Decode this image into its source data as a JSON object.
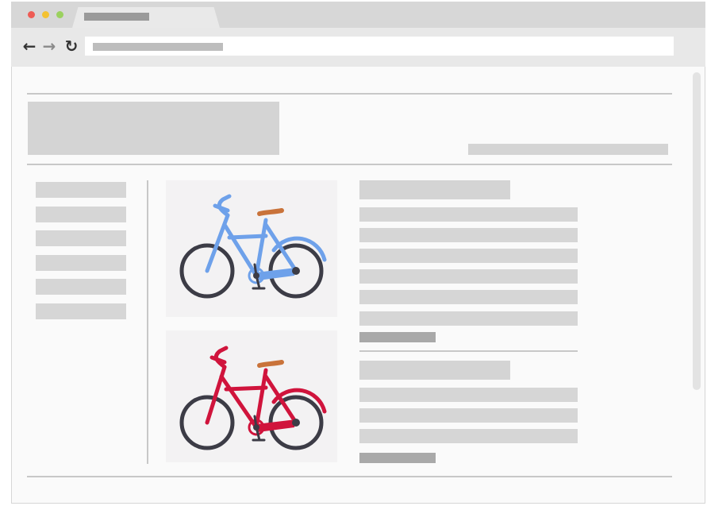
{
  "window": {
    "traffic_lights": {
      "close": "#ee5c55",
      "minimize": "#f4c232",
      "maximize": "#9bd15f"
    }
  },
  "toolbar": {
    "back_icon": "←",
    "forward_icon": "→",
    "reload_icon": "↻"
  },
  "products": [
    {
      "icon": "bicycle-icon",
      "color": "#6ea1ea"
    },
    {
      "icon": "bicycle-icon",
      "color": "#d0143c"
    }
  ],
  "colors": {
    "placeholder": "#d4d4d4",
    "placeholder_dark": "#a9a9a9",
    "divider": "#c8c8c8",
    "saddle": "#c9733a"
  }
}
